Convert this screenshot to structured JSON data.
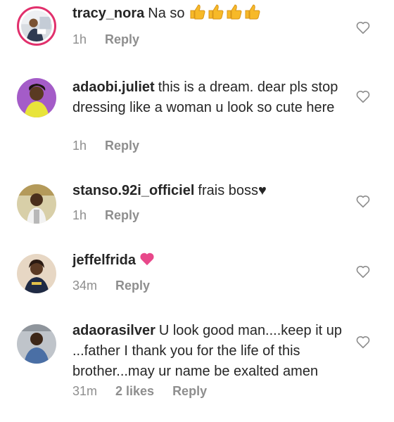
{
  "comments": [
    {
      "username": "tracy_nora",
      "text": "Na so",
      "emoji": "👍👍👍👍",
      "time": "1h",
      "reply_label": "Reply",
      "has_story_ring": true
    },
    {
      "username": "adaobi.juliet",
      "text": "this is a dream. dear pls stop dressing like a woman u look so cute here",
      "time": "1h",
      "reply_label": "Reply"
    },
    {
      "username": "stanso.92i_officiel",
      "text": "frais boss♥",
      "time": "1h",
      "reply_label": "Reply"
    },
    {
      "username": "jeffelfrida",
      "text": "",
      "emoji_icon": "pink-heart-icon",
      "time": "34m",
      "reply_label": "Reply"
    },
    {
      "username": "adaorasilver",
      "text": "U look good man....keep it up ...father I thank you for the life of this brother...may ur name be exalted amen",
      "time": "31m",
      "likes": "2 likes",
      "reply_label": "Reply"
    }
  ],
  "colors": {
    "text": "#262626",
    "meta": "#8e8e8e",
    "heart_emoji": "#e8488a",
    "thumbs": "#f7b928",
    "story_ring": "#e1306c"
  },
  "icons": {
    "like_button": "heart-outline-icon"
  }
}
